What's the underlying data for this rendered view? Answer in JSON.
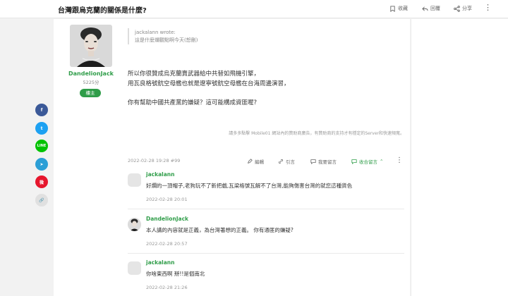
{
  "header": {
    "title": "台灣跟烏克蘭的關係是什麼?",
    "actions": [
      {
        "label": "收藏",
        "icon": "bookmark-icon"
      },
      {
        "label": "回覆",
        "icon": "reply-icon"
      },
      {
        "label": "分享",
        "icon": "share-icon"
      }
    ],
    "more": "⋮"
  },
  "author": {
    "name": "DandelionJack",
    "score": "5225分",
    "badge": "樓主"
  },
  "quote": {
    "author_line": "jackalann wrote:",
    "text": "這是什麼爛觀點啊今天(恕刪)"
  },
  "post": {
    "lines": [
      "所以你很贊成烏克蘭賣武器給中共替如飛機引擎，",
      "用瓦良格號航空母艦也就是遼寧號航空母艦在台海周邊演習，",
      "",
      "你有幫助中國共產黨的嫌疑？這可能構成資匪喔?"
    ],
    "ad_note": "請多多點擊 Mobile01 網站內的贊助商廣告，有贊助商的支持才有穩定的Server和快速頻寬。",
    "meta": "2022-02-28 19:28 #99",
    "actions": {
      "edit": "編輯",
      "quote": "引言",
      "reply": "我要留言",
      "collapse": "收合留言"
    },
    "more": "⋮"
  },
  "comments": [
    {
      "name": "jackalann",
      "text": "好爛的一頂帽子,老狗玩不了新把戲,瓦梁格號瓦解不了台灣,能夠傷害台灣的就您這種貨色",
      "time": "2022-02-28 20:01",
      "avatar": "default"
    },
    {
      "name": "DandelionJack",
      "text": "本人講的內容就是正義，為台灣著想的正義。 你有通匪的嫌疑?",
      "time": "2022-02-28 20:57",
      "avatar": "photo"
    },
    {
      "name": "jackalann",
      "text": "你啥東西啊 掰!!是個南北",
      "time": "2022-02-28 21:26",
      "avatar": "default"
    }
  ],
  "share_buttons": [
    {
      "label": "f",
      "color": "#3b5998",
      "name": "facebook-share-icon"
    },
    {
      "label": "t",
      "color": "#1da1f2",
      "name": "twitter-share-icon"
    },
    {
      "label": "LINE",
      "color": "#00c300",
      "name": "line-share-icon"
    },
    {
      "label": "➤",
      "color": "#2c9fd6",
      "name": "telegram-share-icon"
    },
    {
      "label": "微",
      "color": "#e6162d",
      "name": "weibo-share-icon"
    },
    {
      "label": "🔗",
      "color": "#e0e0e0",
      "name": "link-share-icon"
    }
  ]
}
